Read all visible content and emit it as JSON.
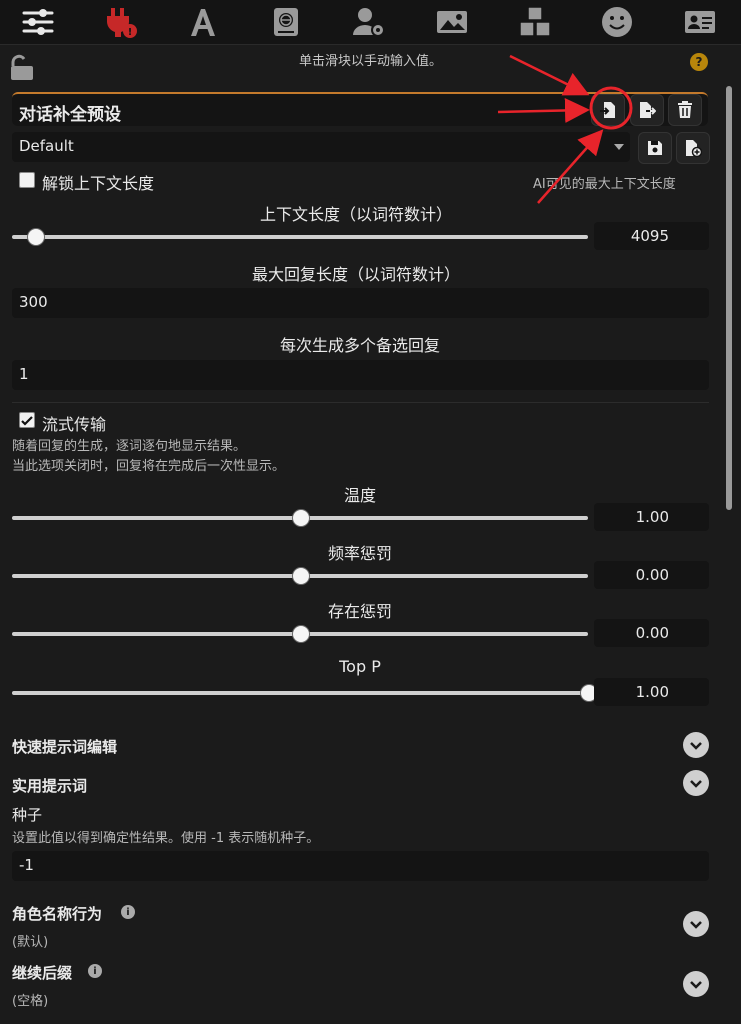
{
  "nav": {
    "items": [
      {
        "icon": "sliders-icon"
      },
      {
        "icon": "plug-alert-icon"
      },
      {
        "icon": "font-icon"
      },
      {
        "icon": "book-globe-icon"
      },
      {
        "icon": "user-gear-icon"
      },
      {
        "icon": "image-icon"
      },
      {
        "icon": "cubes-icon"
      },
      {
        "icon": "smiley-icon"
      },
      {
        "icon": "id-card-icon"
      }
    ]
  },
  "hint": "单击滑块以手动输入值。",
  "help_symbol": "?",
  "preset": {
    "title": "对话补全预设",
    "selected": "Default"
  },
  "unlock_context": {
    "label": "解锁上下文长度",
    "checked": false,
    "hint": "AI可见的最大上下文长度"
  },
  "context_length": {
    "label": "上下文长度（以词符数计）",
    "value": "4095",
    "fraction": 0.04
  },
  "max_response": {
    "label": "最大回复长度（以词符数计）",
    "value": "300"
  },
  "multi_swipe": {
    "label": "每次生成多个备选回复",
    "value": "1"
  },
  "streaming": {
    "label": "流式传输",
    "checked": true,
    "desc1": "随着回复的生成，逐词逐句地显示结果。",
    "desc2": "当此选项关闭时，回复将在完成后一次性显示。"
  },
  "sliders": [
    {
      "label": "温度",
      "value": "1.00",
      "fraction": 0.5
    },
    {
      "label": "频率惩罚",
      "value": "0.00",
      "fraction": 0.5
    },
    {
      "label": "存在惩罚",
      "value": "0.00",
      "fraction": 0.5
    },
    {
      "label": "Top P",
      "value": "1.00",
      "fraction": 1.0
    }
  ],
  "sections": {
    "quick_prompts": "快速提示词编辑",
    "utility_prompts": "实用提示词"
  },
  "seed": {
    "label": "种子",
    "desc": "设置此值以得到确定性结果。使用 -1 表示随机种子。",
    "value": "-1"
  },
  "char_name_behavior": {
    "label": "角色名称行为",
    "value": "(默认)"
  },
  "continue_suffix": {
    "label": "继续后缀",
    "value": "(空格)"
  },
  "colors": {
    "accent": "#c47a2c",
    "annotation": "#e8242b",
    "plug": "#c62828"
  }
}
